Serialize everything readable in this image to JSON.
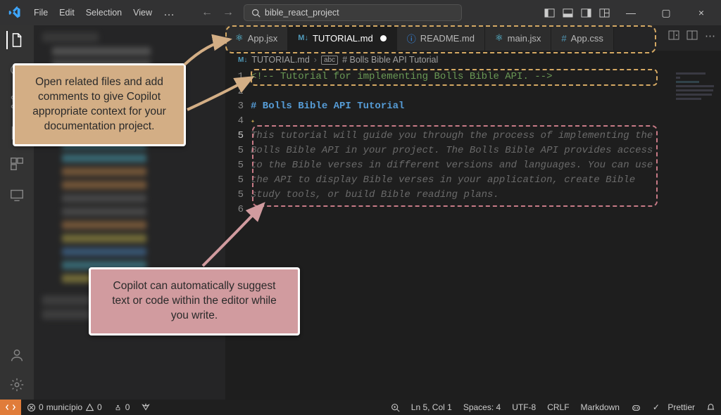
{
  "menubar": {
    "items": [
      "File",
      "Edit",
      "Selection",
      "View"
    ],
    "dots": "…"
  },
  "search": {
    "placeholder": "bible_react_project",
    "icon": "search-icon"
  },
  "window_controls": {
    "min": "—",
    "max": "▢",
    "close": "×"
  },
  "tabs": [
    {
      "icon": "react-icon",
      "label": "App.jsx",
      "active": false
    },
    {
      "icon": "md-icon",
      "label": "TUTORIAL.md",
      "active": true,
      "dirty": true
    },
    {
      "icon": "info-icon",
      "label": "README.md",
      "active": false
    },
    {
      "icon": "react-icon",
      "label": "main.jsx",
      "active": false
    },
    {
      "icon": "css-icon",
      "label": "App.css",
      "active": false
    }
  ],
  "breadcrumb": {
    "file_icon": "md-icon",
    "file": "TUTORIAL.md",
    "sep": "›",
    "symbol_icon": "heading-icon",
    "symbol": "# Bolls Bible API Tutorial"
  },
  "editor": {
    "gutter": [
      "1",
      "2",
      "3",
      "4",
      "5",
      "5",
      "5",
      "5",
      "5",
      "6"
    ],
    "line1": "<!-- Tutorial for implementing Bolls Bible API. -->",
    "line3": "# Bolls Bible API Tutorial",
    "suggestion": [
      "This tutorial will guide you through the process of implementing the",
      "Bolls Bible API in your project. The Bolls Bible API provides access",
      "to the Bible verses in different versions and languages. You can use",
      "the API to display Bible verses in your application, create Bible",
      "study tools, or build Bible reading plans."
    ]
  },
  "callouts": {
    "tan": "Open related files and add comments to give Copilot appropriate context for your documentation project.",
    "pink": "Copilot can automatically suggest text or code within the editor while you write."
  },
  "statusbar": {
    "errors": "0",
    "warnings": "0",
    "ports": "0",
    "ln_col": "Ln 5, Col 1",
    "spaces": "Spaces: 4",
    "encoding": "UTF-8",
    "eol": "CRLF",
    "lang": "Markdown",
    "prettier": "Prettier",
    "prettier_check": "✓"
  },
  "colors": {
    "tan": "#d3ae85",
    "pink": "#d19b9f",
    "dash_tan": "#d4a863",
    "dash_pink": "#c77a86"
  }
}
